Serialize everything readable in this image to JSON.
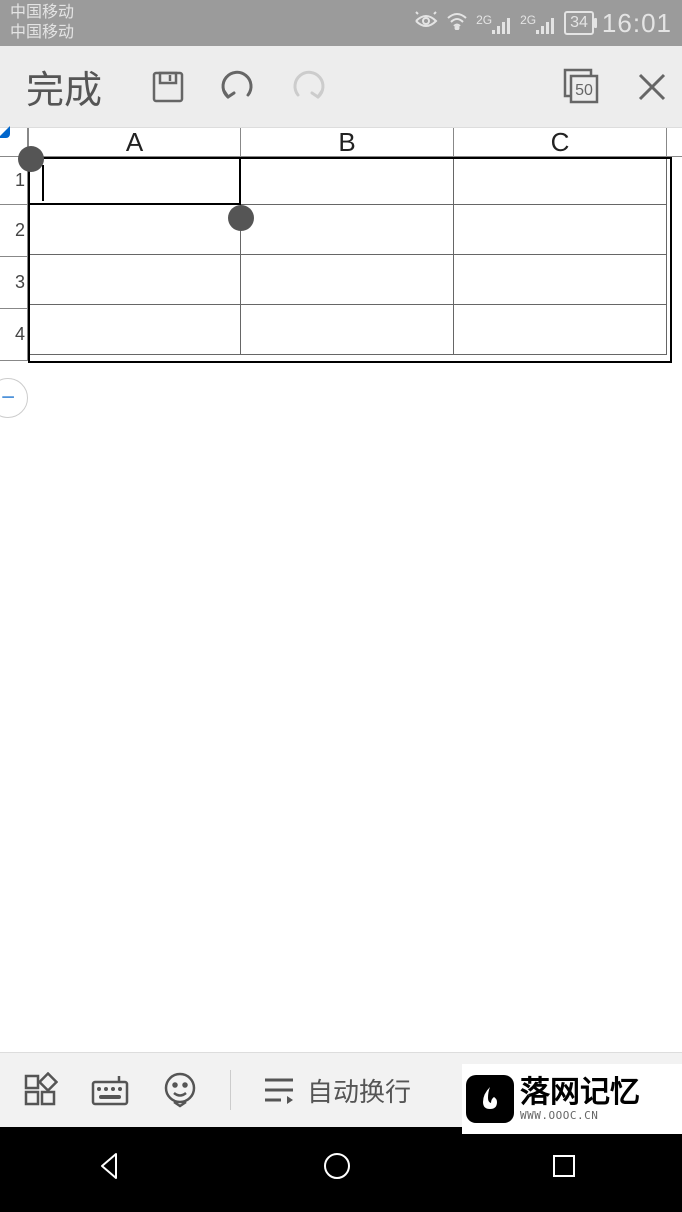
{
  "status_bar": {
    "carrier1": "中国移动",
    "carrier2": "中国移动",
    "network1": "2G",
    "network2": "2G",
    "battery": "34",
    "time": "16:01"
  },
  "toolbar": {
    "done_label": "完成",
    "word_count": "50"
  },
  "sheet": {
    "columns": [
      "A",
      "B",
      "C"
    ],
    "rows": [
      "1",
      "2",
      "3",
      "4"
    ],
    "selected_cell": "A1",
    "cells": {
      "A1": "",
      "B1": "",
      "C1": "",
      "A2": "",
      "B2": "",
      "C2": "",
      "A3": "",
      "B3": "",
      "C3": "",
      "A4": "",
      "B4": "",
      "C4": ""
    }
  },
  "bottom_bar": {
    "wrap_label": "自动换行"
  },
  "watermark": {
    "main": "落网记忆",
    "sub": "WWW.OOOC.CN"
  },
  "zoom_fab": "−"
}
